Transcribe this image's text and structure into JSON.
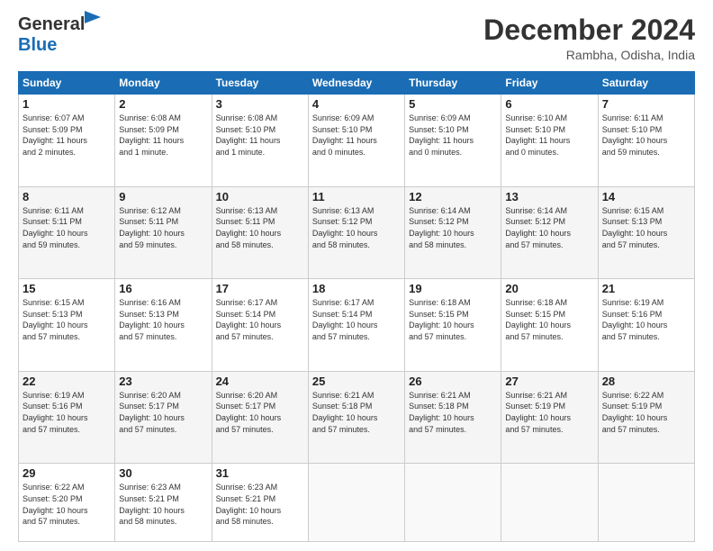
{
  "header": {
    "logo_line1": "General",
    "logo_line2": "Blue",
    "month": "December 2024",
    "location": "Rambha, Odisha, India"
  },
  "weekdays": [
    "Sunday",
    "Monday",
    "Tuesday",
    "Wednesday",
    "Thursday",
    "Friday",
    "Saturday"
  ],
  "weeks": [
    [
      {
        "day": "1",
        "lines": [
          "Sunrise: 6:07 AM",
          "Sunset: 5:09 PM",
          "Daylight: 11 hours",
          "and 2 minutes."
        ]
      },
      {
        "day": "2",
        "lines": [
          "Sunrise: 6:08 AM",
          "Sunset: 5:09 PM",
          "Daylight: 11 hours",
          "and 1 minute."
        ]
      },
      {
        "day": "3",
        "lines": [
          "Sunrise: 6:08 AM",
          "Sunset: 5:10 PM",
          "Daylight: 11 hours",
          "and 1 minute."
        ]
      },
      {
        "day": "4",
        "lines": [
          "Sunrise: 6:09 AM",
          "Sunset: 5:10 PM",
          "Daylight: 11 hours",
          "and 0 minutes."
        ]
      },
      {
        "day": "5",
        "lines": [
          "Sunrise: 6:09 AM",
          "Sunset: 5:10 PM",
          "Daylight: 11 hours",
          "and 0 minutes."
        ]
      },
      {
        "day": "6",
        "lines": [
          "Sunrise: 6:10 AM",
          "Sunset: 5:10 PM",
          "Daylight: 11 hours",
          "and 0 minutes."
        ]
      },
      {
        "day": "7",
        "lines": [
          "Sunrise: 6:11 AM",
          "Sunset: 5:10 PM",
          "Daylight: 10 hours",
          "and 59 minutes."
        ]
      }
    ],
    [
      {
        "day": "8",
        "lines": [
          "Sunrise: 6:11 AM",
          "Sunset: 5:11 PM",
          "Daylight: 10 hours",
          "and 59 minutes."
        ]
      },
      {
        "day": "9",
        "lines": [
          "Sunrise: 6:12 AM",
          "Sunset: 5:11 PM",
          "Daylight: 10 hours",
          "and 59 minutes."
        ]
      },
      {
        "day": "10",
        "lines": [
          "Sunrise: 6:13 AM",
          "Sunset: 5:11 PM",
          "Daylight: 10 hours",
          "and 58 minutes."
        ]
      },
      {
        "day": "11",
        "lines": [
          "Sunrise: 6:13 AM",
          "Sunset: 5:12 PM",
          "Daylight: 10 hours",
          "and 58 minutes."
        ]
      },
      {
        "day": "12",
        "lines": [
          "Sunrise: 6:14 AM",
          "Sunset: 5:12 PM",
          "Daylight: 10 hours",
          "and 58 minutes."
        ]
      },
      {
        "day": "13",
        "lines": [
          "Sunrise: 6:14 AM",
          "Sunset: 5:12 PM",
          "Daylight: 10 hours",
          "and 57 minutes."
        ]
      },
      {
        "day": "14",
        "lines": [
          "Sunrise: 6:15 AM",
          "Sunset: 5:13 PM",
          "Daylight: 10 hours",
          "and 57 minutes."
        ]
      }
    ],
    [
      {
        "day": "15",
        "lines": [
          "Sunrise: 6:15 AM",
          "Sunset: 5:13 PM",
          "Daylight: 10 hours",
          "and 57 minutes."
        ]
      },
      {
        "day": "16",
        "lines": [
          "Sunrise: 6:16 AM",
          "Sunset: 5:13 PM",
          "Daylight: 10 hours",
          "and 57 minutes."
        ]
      },
      {
        "day": "17",
        "lines": [
          "Sunrise: 6:17 AM",
          "Sunset: 5:14 PM",
          "Daylight: 10 hours",
          "and 57 minutes."
        ]
      },
      {
        "day": "18",
        "lines": [
          "Sunrise: 6:17 AM",
          "Sunset: 5:14 PM",
          "Daylight: 10 hours",
          "and 57 minutes."
        ]
      },
      {
        "day": "19",
        "lines": [
          "Sunrise: 6:18 AM",
          "Sunset: 5:15 PM",
          "Daylight: 10 hours",
          "and 57 minutes."
        ]
      },
      {
        "day": "20",
        "lines": [
          "Sunrise: 6:18 AM",
          "Sunset: 5:15 PM",
          "Daylight: 10 hours",
          "and 57 minutes."
        ]
      },
      {
        "day": "21",
        "lines": [
          "Sunrise: 6:19 AM",
          "Sunset: 5:16 PM",
          "Daylight: 10 hours",
          "and 57 minutes."
        ]
      }
    ],
    [
      {
        "day": "22",
        "lines": [
          "Sunrise: 6:19 AM",
          "Sunset: 5:16 PM",
          "Daylight: 10 hours",
          "and 57 minutes."
        ]
      },
      {
        "day": "23",
        "lines": [
          "Sunrise: 6:20 AM",
          "Sunset: 5:17 PM",
          "Daylight: 10 hours",
          "and 57 minutes."
        ]
      },
      {
        "day": "24",
        "lines": [
          "Sunrise: 6:20 AM",
          "Sunset: 5:17 PM",
          "Daylight: 10 hours",
          "and 57 minutes."
        ]
      },
      {
        "day": "25",
        "lines": [
          "Sunrise: 6:21 AM",
          "Sunset: 5:18 PM",
          "Daylight: 10 hours",
          "and 57 minutes."
        ]
      },
      {
        "day": "26",
        "lines": [
          "Sunrise: 6:21 AM",
          "Sunset: 5:18 PM",
          "Daylight: 10 hours",
          "and 57 minutes."
        ]
      },
      {
        "day": "27",
        "lines": [
          "Sunrise: 6:21 AM",
          "Sunset: 5:19 PM",
          "Daylight: 10 hours",
          "and 57 minutes."
        ]
      },
      {
        "day": "28",
        "lines": [
          "Sunrise: 6:22 AM",
          "Sunset: 5:19 PM",
          "Daylight: 10 hours",
          "and 57 minutes."
        ]
      }
    ],
    [
      {
        "day": "29",
        "lines": [
          "Sunrise: 6:22 AM",
          "Sunset: 5:20 PM",
          "Daylight: 10 hours",
          "and 57 minutes."
        ]
      },
      {
        "day": "30",
        "lines": [
          "Sunrise: 6:23 AM",
          "Sunset: 5:21 PM",
          "Daylight: 10 hours",
          "and 58 minutes."
        ]
      },
      {
        "day": "31",
        "lines": [
          "Sunrise: 6:23 AM",
          "Sunset: 5:21 PM",
          "Daylight: 10 hours",
          "and 58 minutes."
        ]
      },
      null,
      null,
      null,
      null
    ]
  ]
}
